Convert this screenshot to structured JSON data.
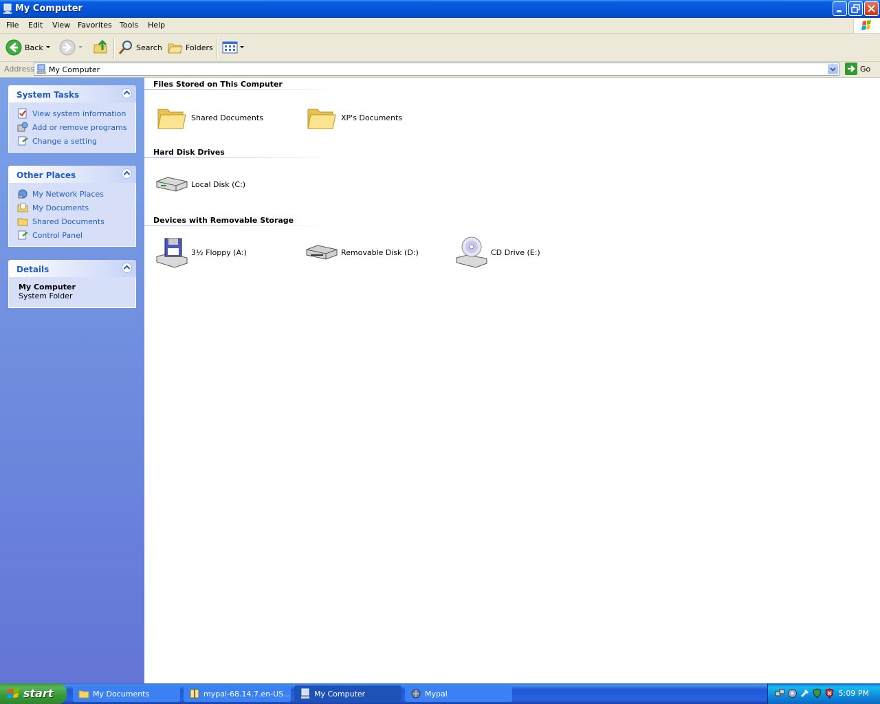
{
  "window": {
    "title": "My Computer"
  },
  "menu": [
    "File",
    "Edit",
    "View",
    "Favorites",
    "Tools",
    "Help"
  ],
  "toolbar": {
    "back": "Back",
    "search": "Search",
    "folders": "Folders"
  },
  "address": {
    "label": "Address",
    "value": "My Computer",
    "go": "Go"
  },
  "taskpane": {
    "system_tasks": {
      "title": "System Tasks",
      "items": [
        "View system information",
        "Add or remove programs",
        "Change a setting"
      ]
    },
    "other_places": {
      "title": "Other Places",
      "items": [
        "My Network Places",
        "My Documents",
        "Shared Documents",
        "Control Panel"
      ]
    },
    "details": {
      "title": "Details",
      "name": "My Computer",
      "type": "System Folder"
    }
  },
  "content": {
    "groups": [
      {
        "title": "Files Stored on This Computer",
        "items": [
          "Shared Documents",
          "XP's Documents"
        ]
      },
      {
        "title": "Hard Disk Drives",
        "items": [
          "Local Disk (C:)"
        ]
      },
      {
        "title": "Devices with Removable Storage",
        "items": [
          "3½ Floppy (A:)",
          "Removable Disk (D:)",
          "CD Drive (E:)"
        ]
      }
    ]
  },
  "taskbar": {
    "start": "start",
    "tasks": [
      "My Documents",
      "mypal-68.14.7.en-US...",
      "My Computer",
      "Mypal"
    ],
    "clock": "5:09 PM"
  },
  "colors": {
    "title_blue": "#0454d8",
    "link_blue": "#215dc6",
    "pane_blue": "#7ba2e7",
    "start_green": "#379937"
  }
}
